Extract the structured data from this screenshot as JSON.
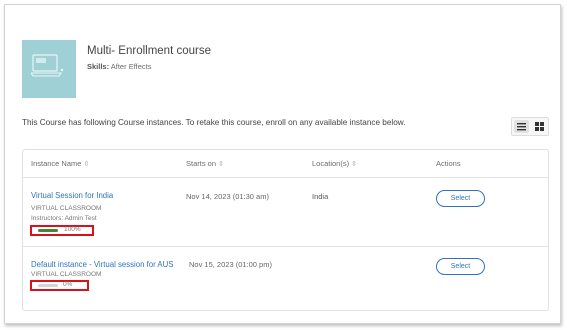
{
  "course": {
    "title": "Multi- Enrollment course",
    "skills_label": "Skills:",
    "skills_value": "After Effects"
  },
  "info_text": "This Course has following Course instances. To retake this course, enroll on any available instance below.",
  "table": {
    "headers": {
      "instance_name": "Instance Name",
      "starts_on": "Starts on",
      "location": "Location(s)",
      "actions": "Actions"
    },
    "rows": [
      {
        "name": "Virtual Session for India",
        "type": "VIRTUAL CLASSROOM",
        "instructors": "Instructors: Admin Test",
        "progress_label": "100%",
        "progress": 100,
        "starts_on": "Nov 14, 2023 (01:30 am)",
        "location": "India",
        "action": "Select"
      },
      {
        "name": "Default instance - Virtual session for AUS",
        "type": "VIRTUAL CLASSROOM",
        "progress_label": "0%",
        "progress": 0,
        "starts_on": "Nov 15, 2023 (01:00 pm)",
        "location": "",
        "action": "Select"
      }
    ]
  },
  "colors": {
    "accent": "#2f74c0",
    "highlight_box": "#d9111b",
    "progress_fill": "#3a8a3e",
    "thumbnail": "#9fd0d6"
  }
}
